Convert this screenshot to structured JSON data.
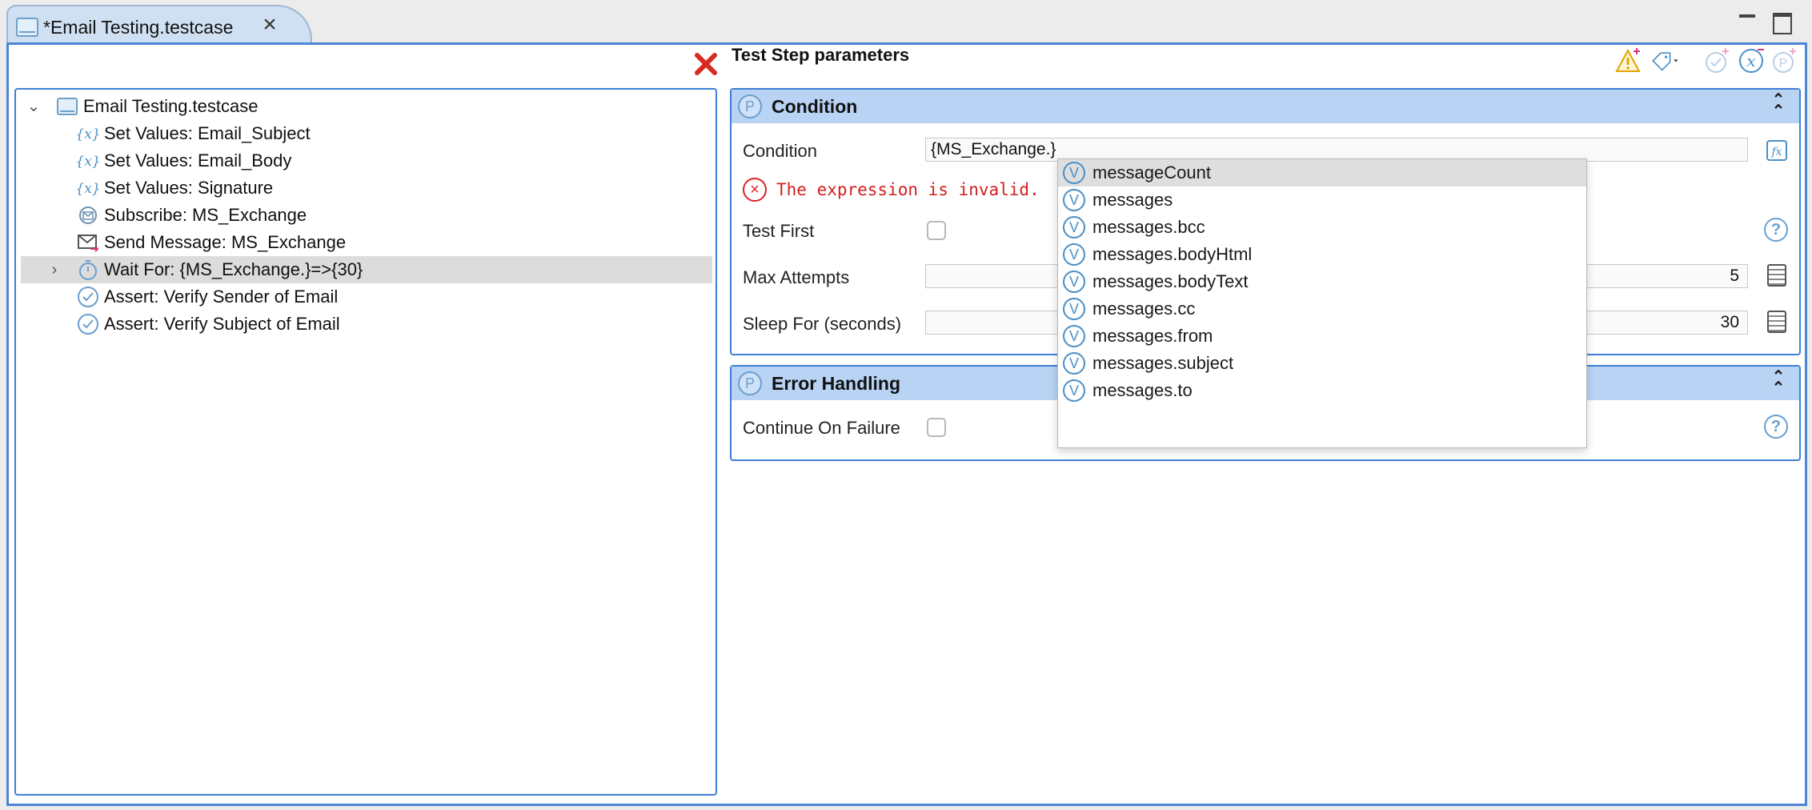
{
  "tab": {
    "title": "*Email Testing.testcase"
  },
  "tree": {
    "root_label": "Email Testing.testcase",
    "items": [
      {
        "label": "Set Values: Email_Subject",
        "icon": "variable-icon"
      },
      {
        "label": "Set Values: Email_Body",
        "icon": "variable-icon"
      },
      {
        "label": "Set Values: Signature",
        "icon": "variable-icon"
      },
      {
        "label": "Subscribe: MS_Exchange",
        "icon": "subscribe-icon"
      },
      {
        "label": "Send Message: MS_Exchange",
        "icon": "send-message-icon"
      },
      {
        "label": "Wait For: {MS_Exchange.}=>{30}",
        "icon": "timer-icon",
        "selected": true
      },
      {
        "label": "Assert: Verify Sender of Email",
        "icon": "checkmark-icon"
      },
      {
        "label": "Assert: Verify Subject of Email",
        "icon": "checkmark-icon"
      }
    ]
  },
  "params": {
    "title": "Test Step parameters",
    "condition_section": {
      "title": "Condition",
      "condition_label": "Condition",
      "condition_value": "{MS_Exchange.}",
      "error_text": "The expression is invalid.",
      "test_first_label": "Test First",
      "max_attempts_label": "Max Attempts",
      "max_attempts_value": "5",
      "sleep_label": "Sleep For (seconds)",
      "sleep_value": "30"
    },
    "error_section": {
      "title": "Error Handling",
      "continue_label": "Continue On Failure"
    }
  },
  "autocomplete": {
    "items": [
      "messageCount",
      "messages",
      "messages.bcc",
      "messages.bodyHtml",
      "messages.bodyText",
      "messages.cc",
      "messages.from",
      "messages.subject",
      "messages.to"
    ],
    "active_index": 0
  },
  "colors": {
    "accent_border": "#3f7fd6",
    "section_header": "#b8d3f4",
    "error": "#d21f1f",
    "selection": "#dcdcdc"
  }
}
